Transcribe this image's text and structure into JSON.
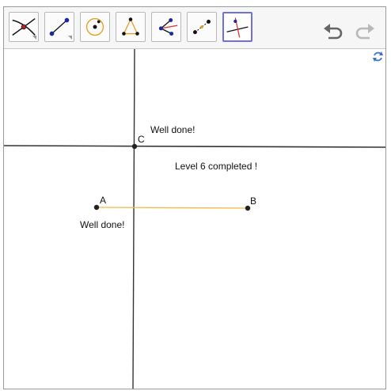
{
  "toolbar": {
    "tools": [
      {
        "name": "intersect-tool",
        "active": false
      },
      {
        "name": "segment-tool",
        "active": false
      },
      {
        "name": "circle-tool",
        "active": false
      },
      {
        "name": "polygon-tool",
        "active": false
      },
      {
        "name": "angle-bisector-tool",
        "active": false
      },
      {
        "name": "midpoint-tool",
        "active": false
      },
      {
        "name": "perpendicular-line-tool",
        "active": true
      }
    ],
    "undo_icon": "undo-icon",
    "redo_icon": "redo-icon"
  },
  "canvas": {
    "refresh_icon": "refresh-icon",
    "points": {
      "A": "A",
      "B": "B",
      "C": "C"
    },
    "messages": {
      "well_done_top": "Well done!",
      "well_done_bottom": "Well done!",
      "level_completed": "Level 6 completed !"
    },
    "colors": {
      "segment": "#f4b84a",
      "lines": "#333333",
      "points": "#222222",
      "active_tool_border": "#6f6fe0",
      "refresh": "#3b6fd6"
    }
  }
}
